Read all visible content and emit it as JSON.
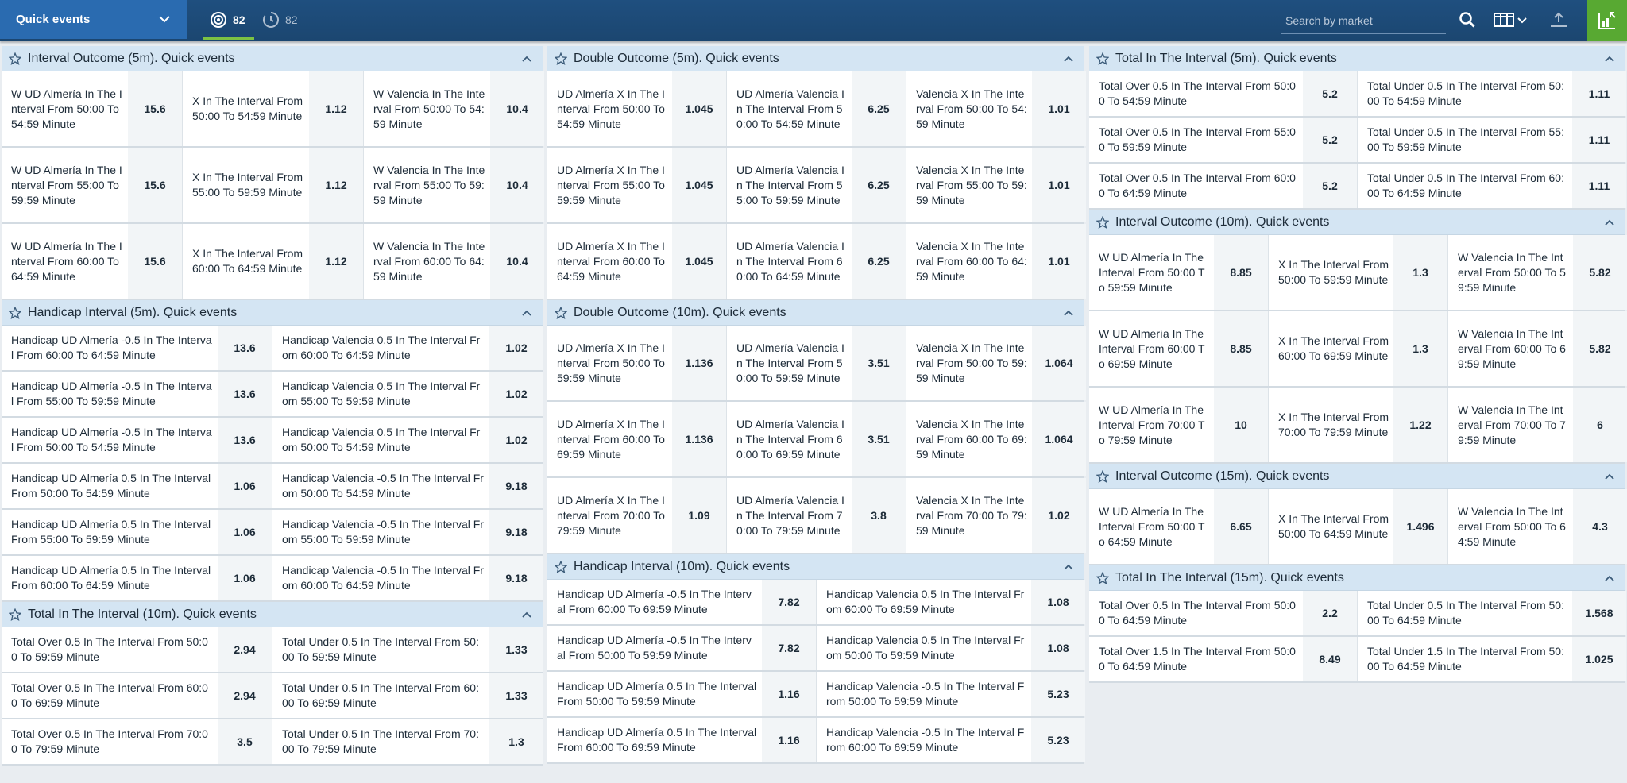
{
  "topbar": {
    "select_label": "Quick events",
    "count_live": "82",
    "count_upcoming": "82",
    "search_placeholder": "Search by market"
  },
  "columns": [
    {
      "sections": [
        {
          "title": "Interval Outcome (5m). Quick events",
          "layout": "three",
          "rows": [
            [
              [
                "W UD Almería In The Interval From 50:00 To 54:59 Minute",
                "15.6"
              ],
              [
                "X In The Interval From 50:00 To 54:59 Minute",
                "1.12"
              ],
              [
                "W Valencia In The Interval From 50:00 To 54:59 Minute",
                "10.4"
              ]
            ],
            [
              [
                "W UD Almería In The Interval From 55:00 To 59:59 Minute",
                "15.6"
              ],
              [
                "X In The Interval From 55:00 To 59:59 Minute",
                "1.12"
              ],
              [
                "W Valencia In The Interval From 55:00 To 59:59 Minute",
                "10.4"
              ]
            ],
            [
              [
                "W UD Almería In The Interval From 60:00 To 64:59 Minute",
                "15.6"
              ],
              [
                "X In The Interval From 60:00 To 64:59 Minute",
                "1.12"
              ],
              [
                "W Valencia In The Interval From 60:00 To 64:59 Minute",
                "10.4"
              ]
            ]
          ]
        },
        {
          "title": "Handicap Interval (5m). Quick events",
          "layout": "two",
          "rows": [
            [
              [
                "Handicap UD Almería -0.5 In The Interval From 60:00 To 64:59 Minute",
                "13.6"
              ],
              [
                "Handicap Valencia 0.5 In The Interval From 60:00 To 64:59 Minute",
                "1.02"
              ]
            ],
            [
              [
                "Handicap UD Almería -0.5 In The Interval From 55:00 To 59:59 Minute",
                "13.6"
              ],
              [
                "Handicap Valencia 0.5 In The Interval From 55:00 To 59:59 Minute",
                "1.02"
              ]
            ],
            [
              [
                "Handicap UD Almería -0.5 In The Interval From 50:00 To 54:59 Minute",
                "13.6"
              ],
              [
                "Handicap Valencia 0.5 In The Interval From 50:00 To 54:59 Minute",
                "1.02"
              ]
            ],
            [
              [
                "Handicap UD Almería 0.5 In The Interval From 50:00 To 54:59 Minute",
                "1.06"
              ],
              [
                "Handicap Valencia -0.5 In The Interval From 50:00 To 54:59 Minute",
                "9.18"
              ]
            ],
            [
              [
                "Handicap UD Almería 0.5 In The Interval From 55:00 To 59:59 Minute",
                "1.06"
              ],
              [
                "Handicap Valencia -0.5 In The Interval From 55:00 To 59:59 Minute",
                "9.18"
              ]
            ],
            [
              [
                "Handicap UD Almería 0.5 In The Interval From 60:00 To 64:59 Minute",
                "1.06"
              ],
              [
                "Handicap Valencia -0.5 In The Interval From 60:00 To 64:59 Minute",
                "9.18"
              ]
            ]
          ]
        },
        {
          "title": "Total In The Interval (10m). Quick events",
          "layout": "two",
          "rows": [
            [
              [
                "Total Over 0.5 In The Interval From 50:00 To 59:59 Minute",
                "2.94"
              ],
              [
                "Total Under 0.5 In The Interval From 50:00 To 59:59 Minute",
                "1.33"
              ]
            ],
            [
              [
                "Total Over 0.5 In The Interval From 60:00 To 69:59 Minute",
                "2.94"
              ],
              [
                "Total Under 0.5 In The Interval From 60:00 To 69:59 Minute",
                "1.33"
              ]
            ],
            [
              [
                "Total Over 0.5 In The Interval From 70:00 To 79:59 Minute",
                "3.5"
              ],
              [
                "Total Under 0.5 In The Interval From 70:00 To 79:59 Minute",
                "1.3"
              ]
            ]
          ]
        }
      ]
    },
    {
      "sections": [
        {
          "title": "Double Outcome (5m). Quick events",
          "layout": "three",
          "rows": [
            [
              [
                "UD Almería X In The Interval From 50:00 To 54:59 Minute",
                "1.045"
              ],
              [
                "UD Almería Valencia In The Interval From 50:00 To 54:59 Minute",
                "6.25"
              ],
              [
                "Valencia X In The Interval From 50:00 To 54:59 Minute",
                "1.01"
              ]
            ],
            [
              [
                "UD Almería X In The Interval From 55:00 To 59:59 Minute",
                "1.045"
              ],
              [
                "UD Almería Valencia In The Interval From 55:00 To 59:59 Minute",
                "6.25"
              ],
              [
                "Valencia X In The Interval From 55:00 To 59:59 Minute",
                "1.01"
              ]
            ],
            [
              [
                "UD Almería X In The Interval From 60:00 To 64:59 Minute",
                "1.045"
              ],
              [
                "UD Almería Valencia In The Interval From 60:00 To 64:59 Minute",
                "6.25"
              ],
              [
                "Valencia X In The Interval From 60:00 To 64:59 Minute",
                "1.01"
              ]
            ]
          ]
        },
        {
          "title": "Double Outcome (10m). Quick events",
          "layout": "three",
          "rows": [
            [
              [
                "UD Almería X In The Interval From 50:00 To 59:59 Minute",
                "1.136"
              ],
              [
                "UD Almería Valencia In The Interval From 50:00 To 59:59 Minute",
                "3.51"
              ],
              [
                "Valencia X In The Interval From 50:00 To 59:59 Minute",
                "1.064"
              ]
            ],
            [
              [
                "UD Almería X In The Interval From 60:00 To 69:59 Minute",
                "1.136"
              ],
              [
                "UD Almería Valencia In The Interval From 60:00 To 69:59 Minute",
                "3.51"
              ],
              [
                "Valencia X In The Interval From 60:00 To 69:59 Minute",
                "1.064"
              ]
            ],
            [
              [
                "UD Almería X In The Interval From 70:00 To 79:59 Minute",
                "1.09"
              ],
              [
                "UD Almería Valencia In The Interval From 70:00 To 79:59 Minute",
                "3.8"
              ],
              [
                "Valencia X In The Interval From 70:00 To 79:59 Minute",
                "1.02"
              ]
            ]
          ]
        },
        {
          "title": "Handicap Interval (10m). Quick events",
          "layout": "two",
          "rows": [
            [
              [
                "Handicap UD Almería -0.5 In The Interval From 60:00 To 69:59 Minute",
                "7.82"
              ],
              [
                "Handicap Valencia 0.5 In The Interval From 60:00 To 69:59 Minute",
                "1.08"
              ]
            ],
            [
              [
                "Handicap UD Almería -0.5 In The Interval From 50:00 To 59:59 Minute",
                "7.82"
              ],
              [
                "Handicap Valencia 0.5 In The Interval From 50:00 To 59:59 Minute",
                "1.08"
              ]
            ],
            [
              [
                "Handicap UD Almería 0.5 In The Interval From 50:00 To 59:59 Minute",
                "1.16"
              ],
              [
                "Handicap Valencia -0.5 In The Interval From 50:00 To 59:59 Minute",
                "5.23"
              ]
            ],
            [
              [
                "Handicap UD Almería 0.5 In The Interval From 60:00 To 69:59 Minute",
                "1.16"
              ],
              [
                "Handicap Valencia -0.5 In The Interval From 60:00 To 69:59 Minute",
                "5.23"
              ]
            ]
          ]
        }
      ]
    },
    {
      "sections": [
        {
          "title": "Total In The Interval (5m). Quick events",
          "layout": "two",
          "rows": [
            [
              [
                "Total Over 0.5 In The Interval From 50:00 To 54:59 Minute",
                "5.2"
              ],
              [
                "Total Under 0.5 In The Interval From 50:00 To 54:59 Minute",
                "1.11"
              ]
            ],
            [
              [
                "Total Over 0.5 In The Interval From 55:00 To 59:59 Minute",
                "5.2"
              ],
              [
                "Total Under 0.5 In The Interval From 55:00 To 59:59 Minute",
                "1.11"
              ]
            ],
            [
              [
                "Total Over 0.5 In The Interval From 60:00 To 64:59 Minute",
                "5.2"
              ],
              [
                "Total Under 0.5 In The Interval From 60:00 To 64:59 Minute",
                "1.11"
              ]
            ]
          ]
        },
        {
          "title": "Interval Outcome (10m). Quick events",
          "layout": "three",
          "rows": [
            [
              [
                "W UD Almería In The Interval From 50:00 To 59:59 Minute",
                "8.85"
              ],
              [
                "X In The Interval From 50:00 To 59:59 Minute",
                "1.3"
              ],
              [
                "W Valencia In The Interval From 50:00 To 59:59 Minute",
                "5.82"
              ]
            ],
            [
              [
                "W UD Almería In The Interval From 60:00 To 69:59 Minute",
                "8.85"
              ],
              [
                "X In The Interval From 60:00 To 69:59 Minute",
                "1.3"
              ],
              [
                "W Valencia In The Interval From 60:00 To 69:59 Minute",
                "5.82"
              ]
            ],
            [
              [
                "W UD Almería In The Interval From 70:00 To 79:59 Minute",
                "10"
              ],
              [
                "X In The Interval From 70:00 To 79:59 Minute",
                "1.22"
              ],
              [
                "W Valencia In The Interval From 70:00 To 79:59 Minute",
                "6"
              ]
            ]
          ]
        },
        {
          "title": "Interval Outcome (15m). Quick events",
          "layout": "three",
          "rows": [
            [
              [
                "W UD Almería In The Interval From 50:00 To 64:59 Minute",
                "6.65"
              ],
              [
                "X In The Interval From 50:00 To 64:59 Minute",
                "1.496"
              ],
              [
                "W Valencia In The Interval From 50:00 To 64:59 Minute",
                "4.3"
              ]
            ]
          ]
        },
        {
          "title": "Total In The Interval (15m). Quick events",
          "layout": "two",
          "rows": [
            [
              [
                "Total Over 0.5 In The Interval From 50:00 To 64:59 Minute",
                "2.2"
              ],
              [
                "Total Under 0.5 In The Interval From 50:00 To 64:59 Minute",
                "1.568"
              ]
            ],
            [
              [
                "Total Over 1.5 In The Interval From 50:00 To 64:59 Minute",
                "8.49"
              ],
              [
                "Total Under 1.5 In The Interval From 50:00 To 64:59 Minute",
                "1.025"
              ]
            ]
          ]
        }
      ]
    }
  ]
}
